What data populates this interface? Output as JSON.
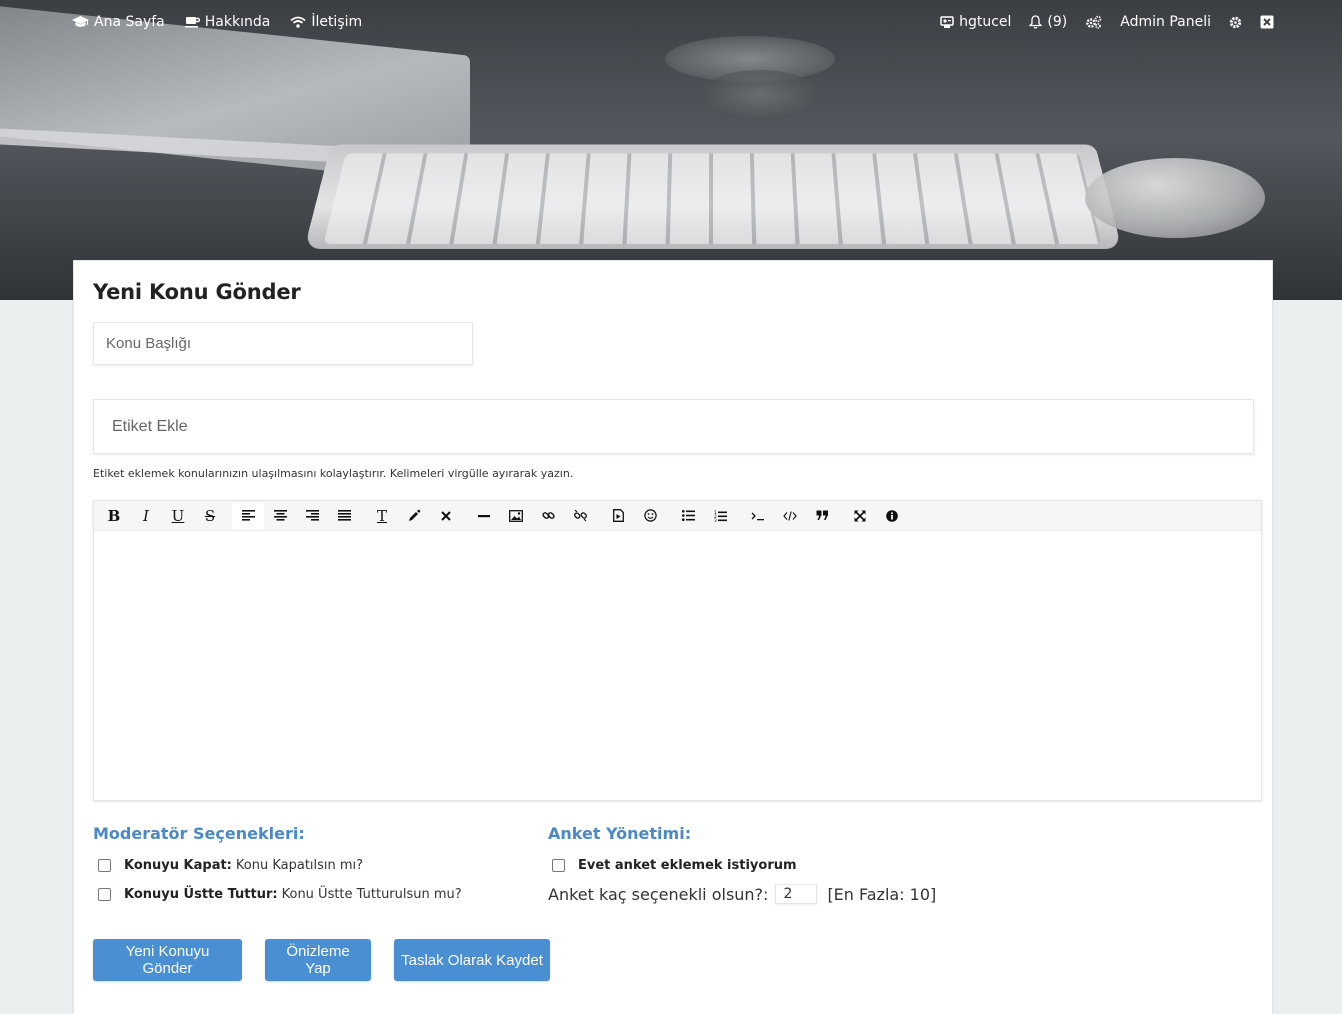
{
  "nav": {
    "left": [
      {
        "label": "Ana Sayfa",
        "icon": "graduation-cap-icon"
      },
      {
        "label": "Hakkında",
        "icon": "coffee-icon"
      },
      {
        "label": "İletişim",
        "icon": "wifi-icon"
      }
    ],
    "user": {
      "label": "hgtucel",
      "icon": "user-card-icon"
    },
    "notifications": {
      "label": "(9)",
      "icon": "bell-icon"
    },
    "admin_label": "Admin Paneli"
  },
  "form": {
    "title": "Yeni Konu Gönder",
    "topic_title_placeholder": "Konu Başlığı",
    "tags_placeholder": "Etiket Ekle",
    "tags_help": "Etiket eklemek konularınızın ulaşılmasını kolaylaştırır. Kelimeleri virgülle ayırarak yazın."
  },
  "editor": {
    "toolbar": [
      "bold",
      "italic",
      "underline",
      "strikethrough",
      "align-left",
      "align-center",
      "align-right",
      "align-justify",
      "font-size",
      "color",
      "remove-format",
      "horizontal-rule",
      "image",
      "link",
      "unlink",
      "youtube",
      "emoticon",
      "bullet-list",
      "numbered-list",
      "code",
      "source",
      "quote",
      "maximize",
      "about"
    ]
  },
  "moderator": {
    "heading": "Moderatör Seçenekleri:",
    "options": [
      {
        "bold": "Konuyu Kapat:",
        "text": "Konu Kapatılsın mı?"
      },
      {
        "bold": "Konuyu Üstte Tuttur:",
        "text": "Konu Üstte Tutturulsun mu?"
      }
    ]
  },
  "poll": {
    "heading": "Anket Yönetimi:",
    "enable_label": "Evet anket eklemek istiyorum",
    "count_label": "Anket kaç seçenekli olsun?:",
    "count_value": "2",
    "max_label": "[En Fazla: 10]"
  },
  "buttons": {
    "submit": "Yeni Konuyu Gönder",
    "preview": "Önizleme Yap",
    "draft": "Taslak Olarak Kaydet"
  },
  "colors": {
    "accent": "#4a8fd1",
    "section_heading": "#4a89c8",
    "page_bg": "#ebeff0"
  }
}
